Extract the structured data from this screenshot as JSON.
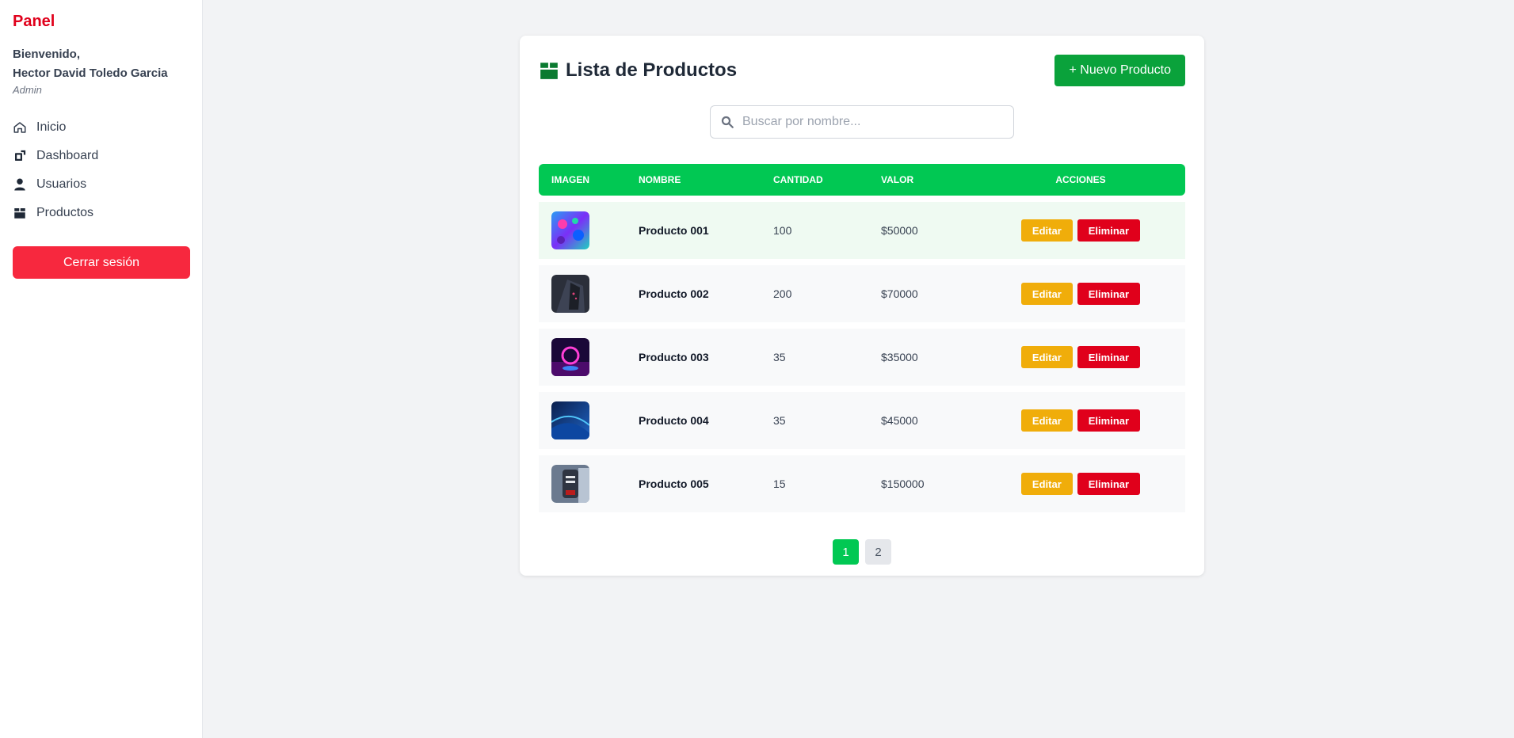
{
  "sidebar": {
    "brand": "Panel",
    "welcome_line": "Bienvenido,",
    "user_name": "Hector David Toledo Garcia",
    "role": "Admin",
    "nav": [
      {
        "label": "Inicio",
        "icon": "home-icon"
      },
      {
        "label": "Dashboard",
        "icon": "dashboard-icon"
      },
      {
        "label": "Usuarios",
        "icon": "user-icon"
      },
      {
        "label": "Productos",
        "icon": "box-icon"
      }
    ],
    "logout_label": "Cerrar sesión"
  },
  "main": {
    "title": "Lista de Productos",
    "new_button": "+ Nuevo Producto",
    "search_placeholder": "Buscar por nombre...",
    "columns": [
      "Imagen",
      "Nombre",
      "Cantidad",
      "Valor",
      "Acciones"
    ],
    "rows": [
      {
        "name": "Producto 001",
        "qty": "100",
        "value": "$50000",
        "thumb": "abstract-blue-pink"
      },
      {
        "name": "Producto 002",
        "qty": "200",
        "value": "$70000",
        "thumb": "dark-building"
      },
      {
        "name": "Producto 003",
        "qty": "35",
        "value": "$35000",
        "thumb": "neon-circle"
      },
      {
        "name": "Producto 004",
        "qty": "35",
        "value": "$45000",
        "thumb": "blue-waves"
      },
      {
        "name": "Producto 005",
        "qty": "15",
        "value": "$150000",
        "thumb": "figure-photo"
      }
    ],
    "edit_label": "Editar",
    "delete_label": "Eliminar",
    "pages": [
      "1",
      "2"
    ],
    "current_page": "1"
  },
  "colors": {
    "brand": "#e0001b",
    "accent_green": "#01c853",
    "new_button": "#0aa23b",
    "logout": "#f7283e",
    "edit": "#f0ad0a",
    "delete": "#e0001b"
  }
}
